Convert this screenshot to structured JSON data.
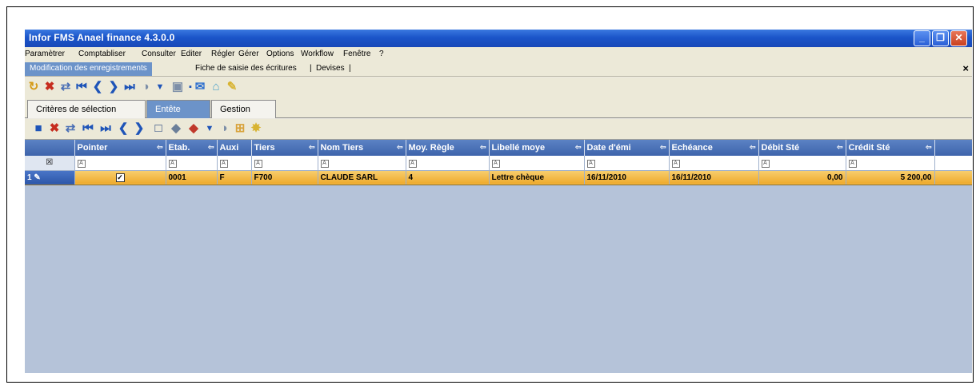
{
  "window": {
    "title": "Infor FMS Anael finance 4.3.0.0",
    "min": "_",
    "max": "❐",
    "close": "✕"
  },
  "menu": [
    "Paramètrer",
    "Comptabliser",
    "Consulter",
    "Editer",
    "Régler",
    "Gérer",
    "Options",
    "Workflow",
    "Fenêtre",
    "?"
  ],
  "doc_tabs": {
    "active": "Modification des enregistrements",
    "others": [
      "Fiche de saisie des écritures",
      "Devises"
    ],
    "close": "×"
  },
  "panel_tabs": [
    "Critères de sélection",
    "Entête",
    "Gestion"
  ],
  "grid": {
    "columns": [
      "Pointer",
      "Etab.",
      "Auxi",
      "Tiers",
      "Nom Tiers",
      "Moy. Règle",
      "Libellé moye",
      "Date d'émi",
      "Echéance",
      "Débit Sté",
      "Crédit Sté"
    ],
    "row": {
      "index": "1",
      "pointer_checked": true,
      "etab": "0001",
      "auxi": "F",
      "tiers": "F700",
      "nom_tiers": "CLAUDE SARL",
      "moy_regle": "4",
      "libelle": "Lettre chèque",
      "date_emission": "16/11/2010",
      "echeance": "16/11/2010",
      "debit": "0,00",
      "credit": "5 200,00"
    }
  },
  "colors": {
    "titlebar": "#1b55c9",
    "header": "#4a6fb5",
    "selected_row": "#f0b33c",
    "grid_bg": "#b5c3d9"
  }
}
